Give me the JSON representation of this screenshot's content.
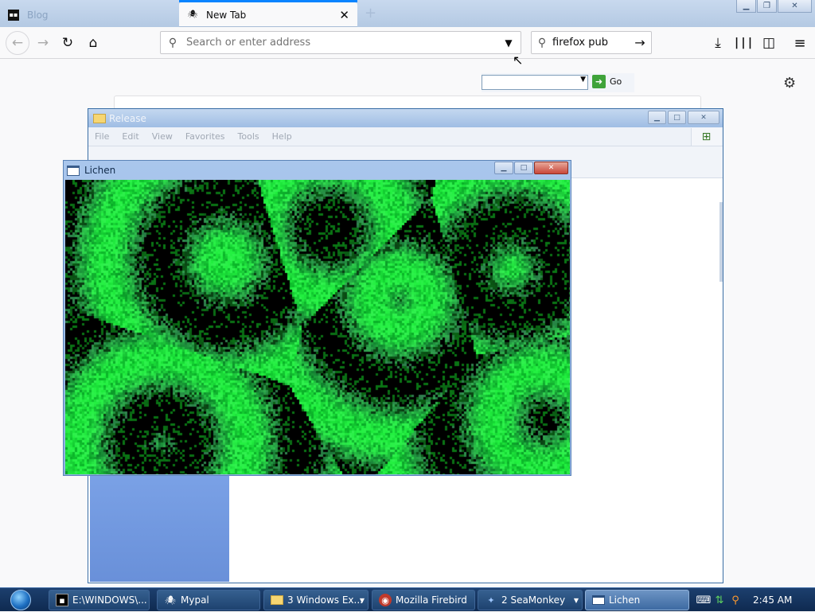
{
  "browser": {
    "tabs": [
      {
        "label": "Blog",
        "active": false
      },
      {
        "label": "New Tab",
        "active": true
      }
    ],
    "url_placeholder": "Search or enter address",
    "search_value": "firefox pub",
    "colors": {
      "accent": "#0a84ff",
      "toolbar": "#f9f9fa"
    }
  },
  "explorer": {
    "title": "Release",
    "menu": [
      "File",
      "Edit",
      "View",
      "Favorites",
      "Tools",
      "Help"
    ],
    "go_label": "Go"
  },
  "lichen": {
    "title": "Lichen",
    "colors": {
      "background": "#000000",
      "growth": "#22c94a"
    }
  },
  "taskbar": {
    "items": [
      {
        "label": "E:\\WINDOWS\\...",
        "icon": "console-icon",
        "active": false
      },
      {
        "label": "Mypal",
        "icon": "mypal-icon",
        "active": false
      },
      {
        "label": "3 Windows Ex...",
        "icon": "folder-icon",
        "active": false
      },
      {
        "label": "Mozilla Firebird",
        "icon": "firebird-icon",
        "active": false
      },
      {
        "label": "2 SeaMonkey",
        "icon": "seamonkey-icon",
        "active": false
      },
      {
        "label": "Lichen",
        "icon": "window-icon",
        "active": true
      }
    ],
    "clock": "2:45 AM"
  }
}
